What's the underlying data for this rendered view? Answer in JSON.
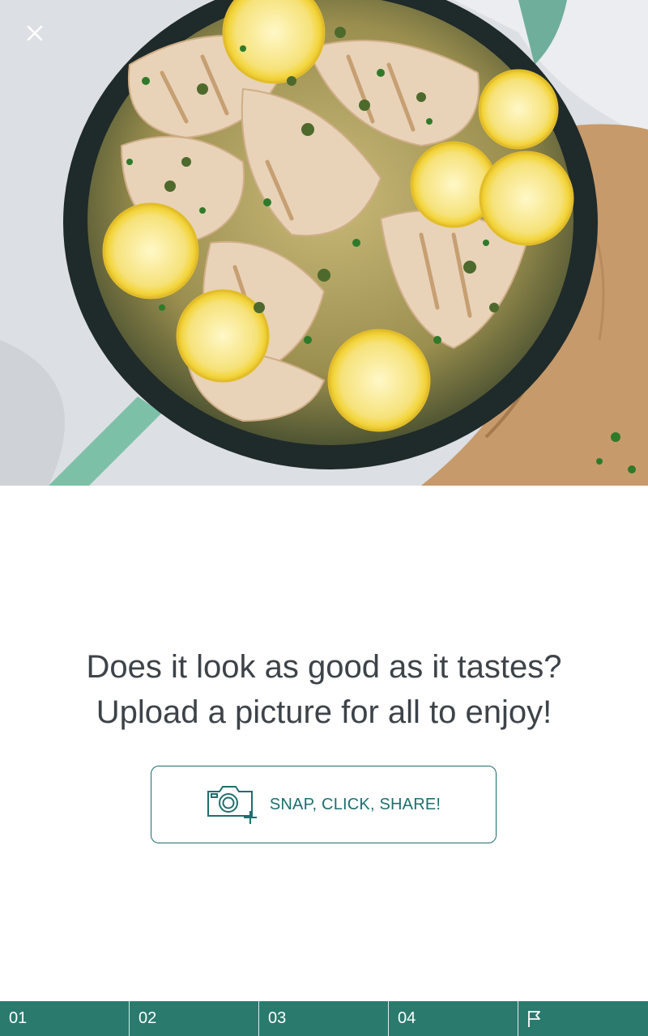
{
  "hero": {
    "image_alt": "Chicken piccata with lemon slices, capers and parsley in a skillet"
  },
  "close": {
    "icon": "close-icon"
  },
  "prompt": {
    "line1": "Does it look as good as it tastes?",
    "line2": "Upload a picture for all to enjoy!"
  },
  "upload_button": {
    "label": "SNAP, CLICK, SHARE!",
    "icon": "camera-add-icon"
  },
  "steps": {
    "items": [
      "01",
      "02",
      "03",
      "04"
    ],
    "finish_icon": "flag-icon"
  },
  "colors": {
    "accent": "#1f6e6e",
    "step_bar": "#2a7a6e",
    "text": "#3d4349"
  }
}
